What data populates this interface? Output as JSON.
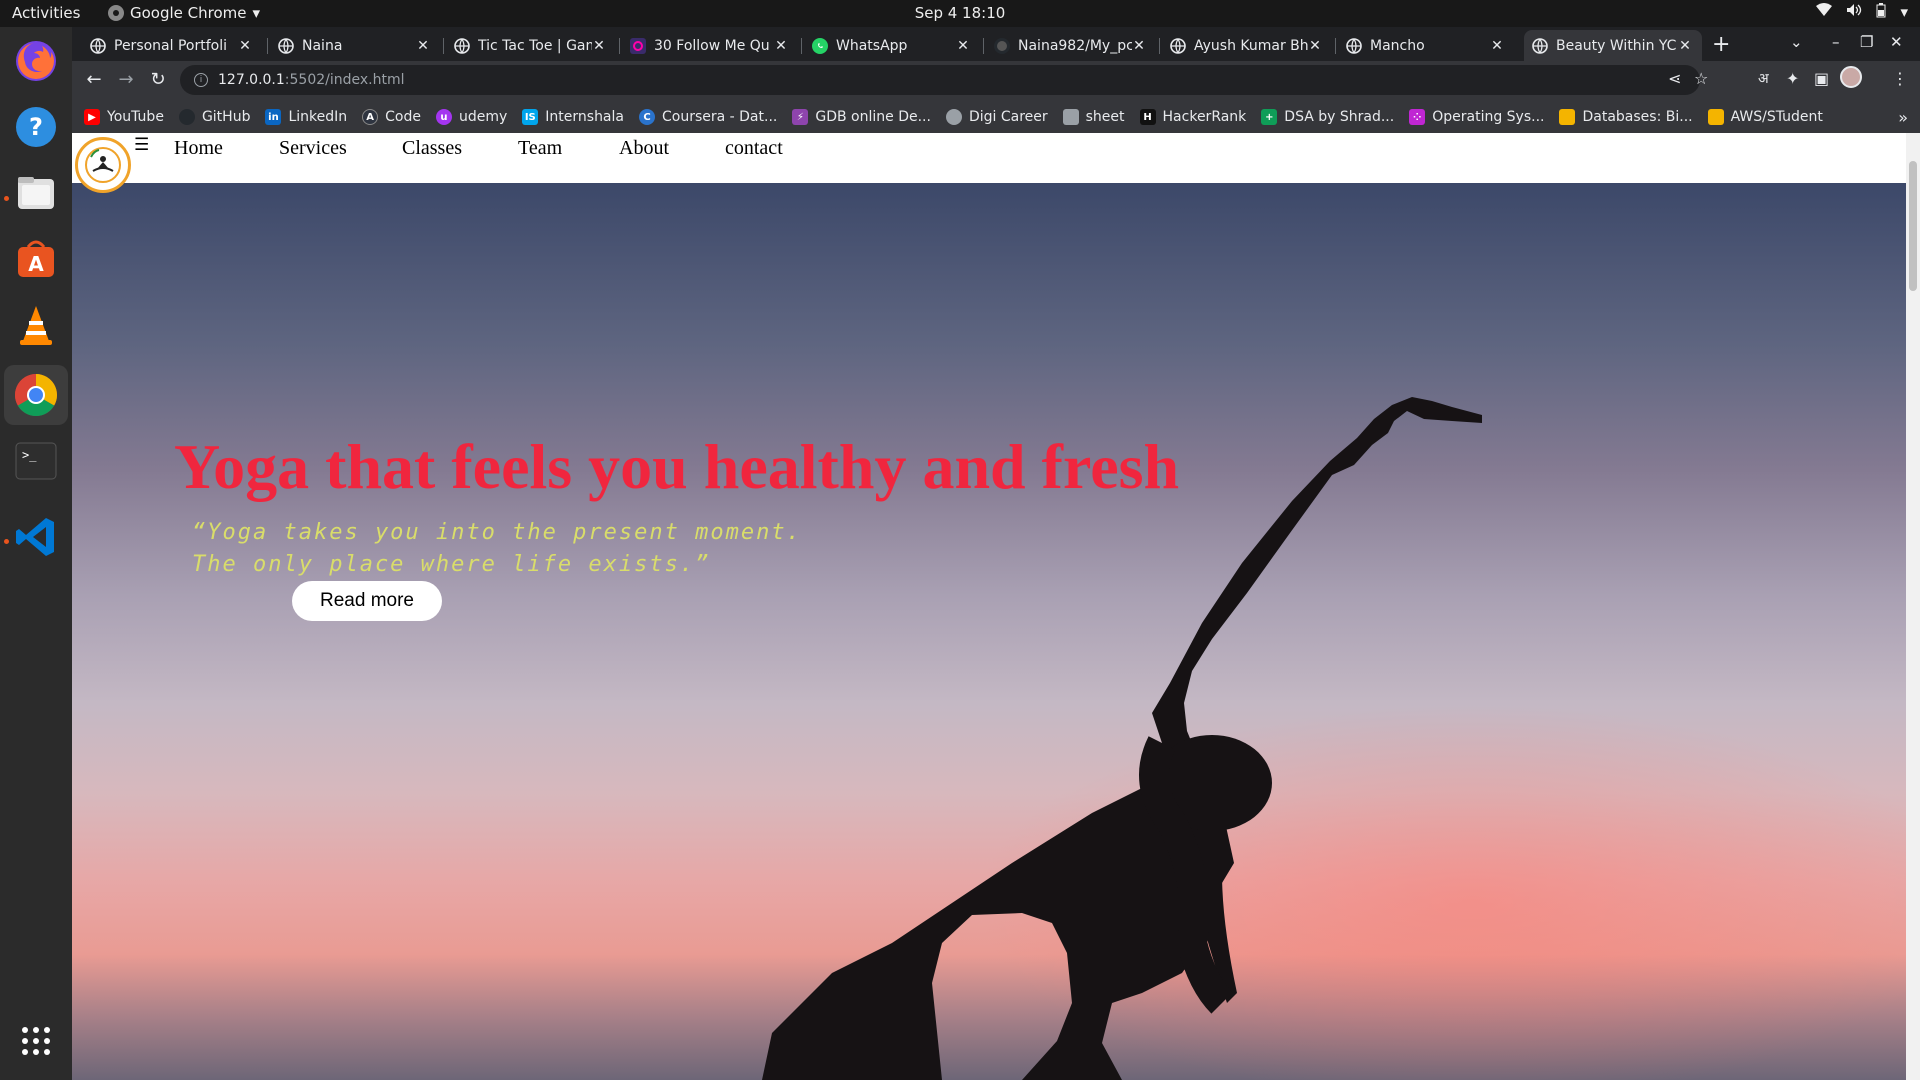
{
  "topbar": {
    "activities": "Activities",
    "app_name": "Google Chrome",
    "clock": "Sep 4  18:10"
  },
  "dock": {
    "items": [
      "firefox-icon",
      "help-icon",
      "files-icon",
      "software-center-icon",
      "vlc-icon",
      "chrome-icon",
      "terminal-icon",
      "vscode-icon"
    ],
    "apps_grid": "show-applications-icon"
  },
  "tabs": [
    {
      "title": "Personal Portfoli",
      "icon": "globe-icon"
    },
    {
      "title": "Naina",
      "icon": "globe-icon"
    },
    {
      "title": "Tic Tac Toe | Gam",
      "icon": "globe-icon"
    },
    {
      "title": "30 Follow Me Qu",
      "icon": "quiz-icon"
    },
    {
      "title": "WhatsApp",
      "icon": "whatsapp-icon"
    },
    {
      "title": "Naina982/My_pc",
      "icon": "github-icon"
    },
    {
      "title": "Ayush Kumar Bh",
      "icon": "globe-icon"
    },
    {
      "title": "Mancho",
      "icon": "globe-icon"
    },
    {
      "title": "Beauty Within YC",
      "icon": "globe-icon",
      "active": true
    }
  ],
  "address_bar": {
    "host": "127.0.0.1",
    "path": ":5502/index.html"
  },
  "bookmarks": [
    {
      "label": "YouTube",
      "color": "#ff0000"
    },
    {
      "label": "GitHub",
      "color": "#24292e"
    },
    {
      "label": "LinkedIn",
      "color": "#0a66c2"
    },
    {
      "label": "Code",
      "color": "#2e3440"
    },
    {
      "label": "udemy",
      "color": "#a435f0"
    },
    {
      "label": "Internshala",
      "color": "#00a5ec"
    },
    {
      "label": "Coursera - Dat...",
      "color": "#2a73cc"
    },
    {
      "label": "GDB online De...",
      "color": "#8e44ad"
    },
    {
      "label": "Digi Career",
      "color": "#9aa0a6"
    },
    {
      "label": "sheet",
      "color": "#9aa0a6"
    },
    {
      "label": "HackerRank",
      "color": "#1ba94c"
    },
    {
      "label": "DSA by Shrad...",
      "color": "#0f9d58"
    },
    {
      "label": "Operating Sys...",
      "color": "#c026d3"
    },
    {
      "label": "Databases: Bi...",
      "color": "#f4b400"
    },
    {
      "label": "AWS/STudent",
      "color": "#f4b400"
    }
  ],
  "site": {
    "nav": [
      "Home",
      "Services",
      "Classes",
      "Team",
      "About",
      "contact"
    ],
    "hero_title": "Yoga that feels you healthy and fresh",
    "quote_line1": "“Yoga takes you into the present moment.",
    "quote_line2": "The only place where life exists.”",
    "cta": "Read more",
    "colors": {
      "title": "#f0263e",
      "quote": "#d9dd6a",
      "logo_ring": "#f0a32a"
    }
  }
}
